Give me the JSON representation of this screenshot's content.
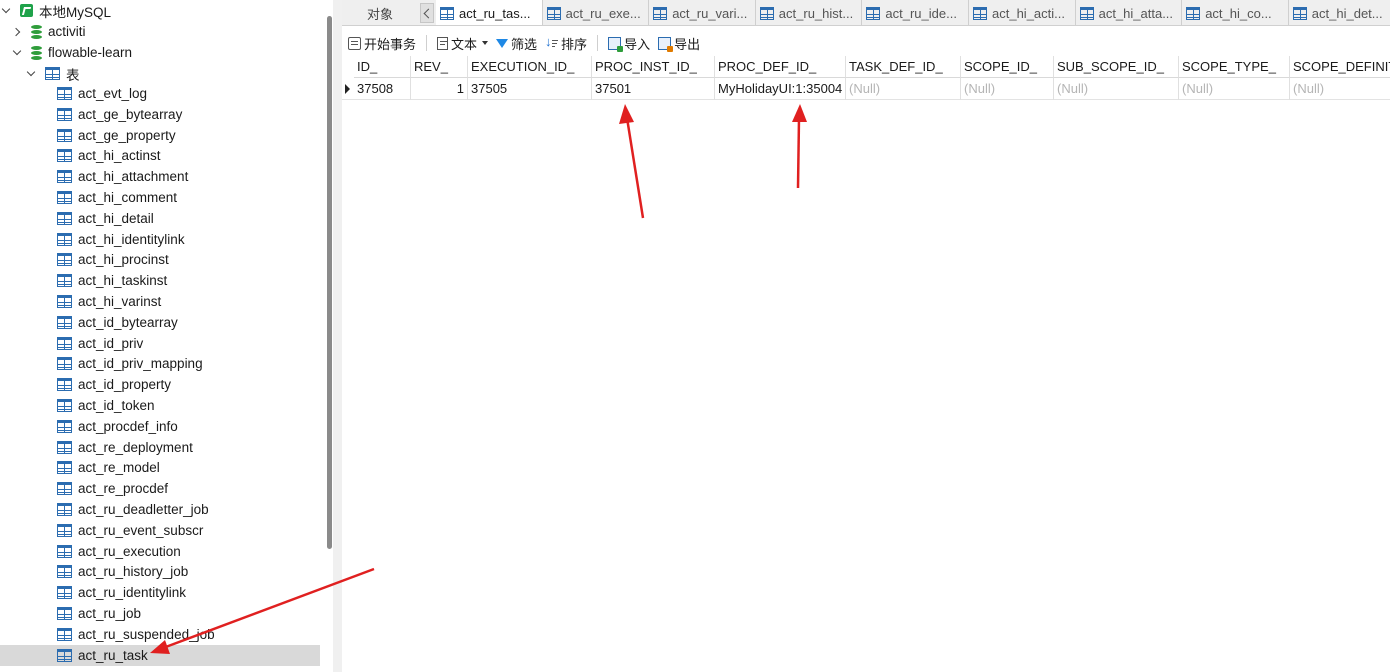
{
  "sidebar": {
    "connection": "本地MySQL",
    "databases": [
      "activiti",
      "flowable-learn"
    ],
    "tables_group": "表",
    "tables": [
      "act_evt_log",
      "act_ge_bytearray",
      "act_ge_property",
      "act_hi_actinst",
      "act_hi_attachment",
      "act_hi_comment",
      "act_hi_detail",
      "act_hi_identitylink",
      "act_hi_procinst",
      "act_hi_taskinst",
      "act_hi_varinst",
      "act_id_bytearray",
      "act_id_priv",
      "act_id_priv_mapping",
      "act_id_property",
      "act_id_token",
      "act_procdef_info",
      "act_re_deployment",
      "act_re_model",
      "act_re_procdef",
      "act_ru_deadletter_job",
      "act_ru_event_subscr",
      "act_ru_execution",
      "act_ru_history_job",
      "act_ru_identitylink",
      "act_ru_job",
      "act_ru_suspended_job",
      "act_ru_task"
    ],
    "selected": "act_ru_task"
  },
  "tabs": {
    "objects": "对象",
    "items": [
      "act_ru_tas...",
      "act_ru_exe...",
      "act_ru_vari...",
      "act_ru_hist...",
      "act_ru_ide...",
      "act_hi_acti...",
      "act_hi_atta...",
      "act_hi_co...",
      "act_hi_det..."
    ]
  },
  "toolbar": {
    "begin_transaction": "开始事务",
    "text": "文本",
    "filter": "筛选",
    "sort": "排序",
    "import": "导入",
    "export": "导出"
  },
  "grid": {
    "columns": [
      "ID_",
      "REV_",
      "EXECUTION_ID_",
      "PROC_INST_ID_",
      "PROC_DEF_ID_",
      "TASK_DEF_ID_",
      "SCOPE_ID_",
      "SUB_SCOPE_ID_",
      "SCOPE_TYPE_",
      "SCOPE_DEFINIT"
    ],
    "rows": [
      [
        "37508",
        "1",
        "37505",
        "37501",
        "MyHolidayUI:1:35004",
        "(Null)",
        "(Null)",
        "(Null)",
        "(Null)",
        "(Null)"
      ]
    ]
  },
  "colors": {
    "annotation_arrow": "#e02020",
    "selected_row": "#d9d9d9",
    "null_text": "#b5b5b5"
  }
}
